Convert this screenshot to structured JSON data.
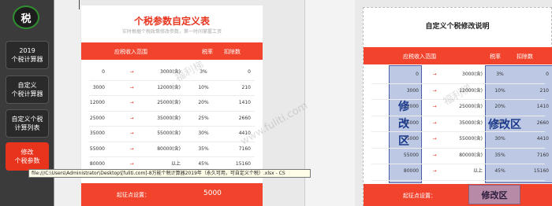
{
  "sidebar": {
    "logo": "税",
    "buttons": [
      {
        "line1": "2019",
        "line2": "个税计算器"
      },
      {
        "line1": "自定义",
        "line2": "个税计算器"
      },
      {
        "line1": "自定义个税",
        "line2": "计算列表"
      },
      {
        "line1": "修改",
        "line2": "个税参数"
      }
    ]
  },
  "card1": {
    "title": "个税参数自定义表",
    "subtitle": "实时根据个税政策修改参数，第一时间掌握工资",
    "headers": {
      "range": "应税收入范围",
      "rate": "税率",
      "deduction": "扣除数"
    },
    "rows": [
      {
        "from": "0",
        "to": "3000(含)",
        "rate": "3%",
        "deduction": "0"
      },
      {
        "from": "3000",
        "to": "12000(含)",
        "rate": "10%",
        "deduction": "210"
      },
      {
        "from": "12000",
        "to": "25000(含)",
        "rate": "20%",
        "deduction": "1410"
      },
      {
        "from": "25000",
        "to": "35000(含)",
        "rate": "25%",
        "deduction": "2660"
      },
      {
        "from": "35000",
        "to": "55000(含)",
        "rate": "30%",
        "deduction": "4410"
      },
      {
        "from": "55000",
        "to": "80000(含)",
        "rate": "35%",
        "deduction": "7160"
      },
      {
        "from": "80000",
        "to": "以上",
        "rate": "45%",
        "deduction": "15160"
      }
    ],
    "threshold_label": "起征点设置：",
    "threshold_value": "5000"
  },
  "card2": {
    "title": "自定义个税修改说明",
    "headers": {
      "range": "应税收入范围",
      "rate": "税率",
      "deduction": "扣除数"
    },
    "rows": [
      {
        "from": "0",
        "to": "3000(含)",
        "rate": "3%",
        "deduction": "0"
      },
      {
        "from": "3000",
        "to": "12000(含)",
        "rate": "10%",
        "deduction": "210"
      },
      {
        "from": "12000",
        "to": "25000(含)",
        "rate": "20%",
        "deduction": "1410"
      },
      {
        "from": "25000",
        "to": "35000(含)",
        "rate": "25%",
        "deduction": "2660"
      },
      {
        "from": "35000",
        "to": "55000(含)",
        "rate": "30%",
        "deduction": "4410"
      },
      {
        "from": "55000",
        "to": "80000(含)",
        "rate": "35%",
        "deduction": "7160"
      },
      {
        "from": "80000",
        "to": "以上",
        "rate": "45%",
        "deduction": "15160"
      }
    ],
    "edit_vertical": [
      "修",
      "改",
      "区"
    ],
    "edit_zone": "修改区",
    "threshold_label": "起征点设置：",
    "threshold_edit": "修改区"
  },
  "tooltip": "file:///C:\\Users\\Administrator\\Desktop\\[fuliti.com]-8万能个税计算器2019年（永久可用，可自定义个税）.xlsx - CS",
  "watermark": [
    "福利梯",
    "www.fuliti.com"
  ]
}
